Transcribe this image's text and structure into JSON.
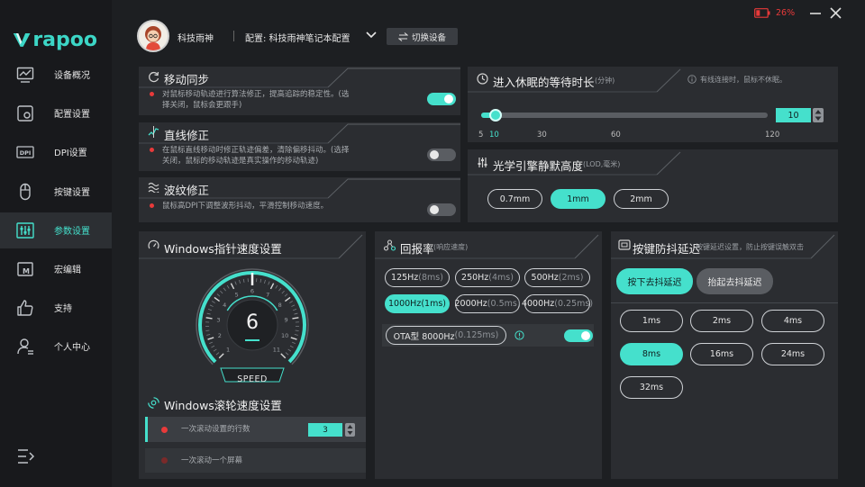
{
  "app": {
    "brand": "rapoo",
    "battery": "26%"
  },
  "header": {
    "username": "科技雨神",
    "config_label": "配置: 科技雨神笔记本配置",
    "switch_button": "切换设备"
  },
  "nav": [
    {
      "label": "设备概况",
      "icon": "monitor-icon"
    },
    {
      "label": "配置设置",
      "icon": "config-icon"
    },
    {
      "label": "DPI设置",
      "icon": "dpi-icon"
    },
    {
      "label": "按键设置",
      "icon": "mouse-icon"
    },
    {
      "label": "参数设置",
      "icon": "sliders-icon",
      "active": true
    },
    {
      "label": "宏编辑",
      "icon": "macro-icon"
    },
    {
      "label": "支持",
      "icon": "thumbs-up-icon"
    },
    {
      "label": "个人中心",
      "icon": "user-icon"
    }
  ],
  "motion_sync": {
    "title": "移动同步",
    "desc": "对鼠标移动轨迹进行算法修正，提高追踪的稳定性。(选择关闭，鼠标会更跟手)",
    "enabled": true
  },
  "angle_snap": {
    "title": "直线修正",
    "desc": "在鼠标直线移动时修正轨迹偏差，清除偏移抖动。(选择关闭，鼠标的移动轨迹是真实操作的移动轨迹)",
    "enabled": false
  },
  "ripple": {
    "title": "波纹修正",
    "desc": "鼠标高DPI下调整波形抖动，平滑控制移动速度。",
    "enabled": false
  },
  "sleep": {
    "title": "进入休眠的等待时长",
    "unit": "(分钟)",
    "note": "有线连接时，鼠标不休眠。",
    "value": "10",
    "ticks": [
      "5",
      "10",
      "30",
      "60",
      "120"
    ],
    "min": 5,
    "max": 120,
    "current": 10
  },
  "lod": {
    "title": "光学引擎静默高度",
    "unit": "(LOD,毫米)",
    "options": [
      "0.7mm",
      "1mm",
      "2mm"
    ],
    "selected": 1
  },
  "pointer": {
    "title": "Windows指针速度设置",
    "value": "6",
    "speed_label": "SPEED",
    "scale": [
      "1",
      "2",
      "3",
      "4",
      "5",
      "6",
      "7",
      "8",
      "9",
      "10",
      "11"
    ]
  },
  "scroll": {
    "title": "Windows滚轮速度设置",
    "option1": "一次滚动设置的行数",
    "lines": "3",
    "option2": "一次滚动一个屏幕"
  },
  "polling": {
    "title": "回报率",
    "subtitle": "(响应速度)",
    "options": [
      {
        "rate": "125Hz",
        "ms": "(8ms)"
      },
      {
        "rate": "250Hz",
        "ms": "(4ms)"
      },
      {
        "rate": "500Hz",
        "ms": "(2ms)"
      },
      {
        "rate": "1000Hz",
        "ms": "(1ms)"
      },
      {
        "rate": "2000Hz",
        "ms": "(0.5ms)"
      },
      {
        "rate": "4000Hz",
        "ms": "(0.25ms)"
      }
    ],
    "selected": 3,
    "ota_label": "OTA型 8000Hz",
    "ota_ms": "(0.125ms)",
    "ota_enabled": true
  },
  "debounce": {
    "title": "按键防抖延迟",
    "subtitle": "按键延迟设置，防止按键误触双击",
    "tab_press": "按下去抖延迟",
    "tab_release": "抬起去抖延迟",
    "options": [
      "1ms",
      "2ms",
      "4ms",
      "8ms",
      "16ms",
      "24ms",
      "32ms"
    ],
    "selected": 3
  },
  "colors": {
    "accent": "#45e0cc",
    "panel": "#2b2d31",
    "bg": "#1d1f22",
    "danger": "#e83a3a"
  }
}
